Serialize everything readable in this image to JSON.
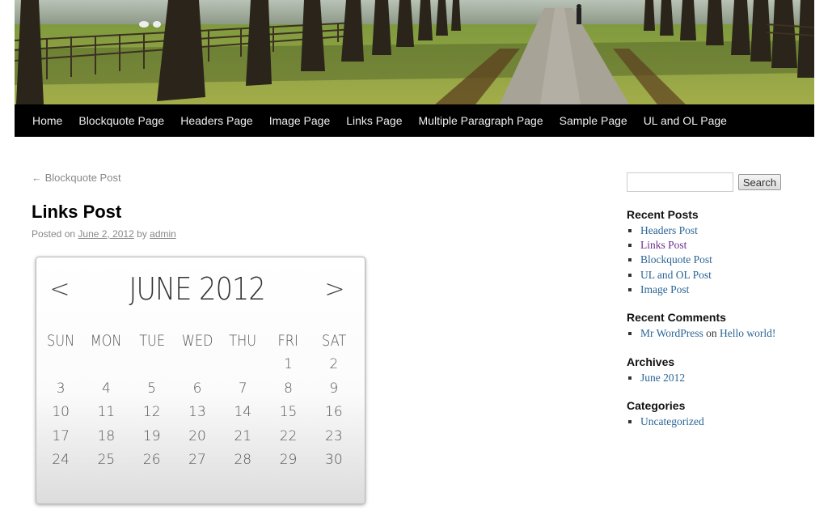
{
  "nav": {
    "items": [
      "Home",
      "Blockquote Page",
      "Headers Page",
      "Image Page",
      "Links Page",
      "Multiple Paragraph Page",
      "Sample Page",
      "UL and OL Page"
    ]
  },
  "post": {
    "prev_link": "← Blockquote Post",
    "title": "Links Post",
    "posted_on": "Posted on",
    "date": "June 2, 2012",
    "by": "by",
    "author": "admin"
  },
  "calendar": {
    "prev_icon": "chevron-left-icon",
    "next_icon": "chevron-right-icon",
    "prev_symbol": "<",
    "next_symbol": ">",
    "month": "JUNE 2012",
    "weekdays": [
      "SUN",
      "MON",
      "TUE",
      "WED",
      "THU",
      "FRI",
      "SAT"
    ],
    "weeks": [
      [
        "",
        "",
        "",
        "",
        "",
        "1",
        "2"
      ],
      [
        "3",
        "4",
        "5",
        "6",
        "7",
        "8",
        "9"
      ],
      [
        "10",
        "11",
        "12",
        "13",
        "14",
        "15",
        "16"
      ],
      [
        "17",
        "18",
        "19",
        "20",
        "21",
        "22",
        "23"
      ],
      [
        "24",
        "25",
        "26",
        "27",
        "28",
        "29",
        "30"
      ]
    ]
  },
  "sidebar": {
    "search": {
      "placeholder": "",
      "button": "Search"
    },
    "recent_posts": {
      "title": "Recent Posts",
      "items": [
        "Headers Post",
        "Links Post",
        "Blockquote Post",
        "UL and OL Post",
        "Image Post"
      ]
    },
    "recent_comments": {
      "title": "Recent Comments",
      "author": "Mr WordPress",
      "on": "on",
      "post": "Hello world!"
    },
    "archives": {
      "title": "Archives",
      "items": [
        "June 2012"
      ]
    },
    "categories": {
      "title": "Categories",
      "items": [
        "Uncategorized"
      ]
    }
  },
  "colors": {
    "nav_bg": "#000000",
    "link": "#2a6496",
    "visited_link": "#6b2d8b"
  }
}
